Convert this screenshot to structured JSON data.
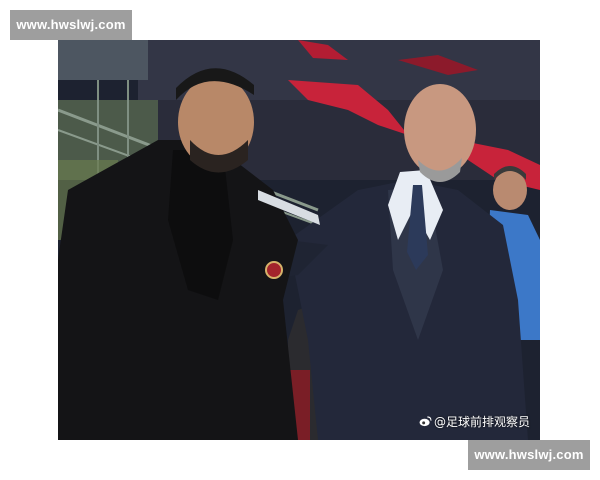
{
  "watermark": {
    "top_text": "www.hwslwj.com",
    "bottom_text": "www.hwslwj.com"
  },
  "photo": {
    "credit": "@足球前排观察员",
    "credit_icon": "weibo-icon"
  },
  "colors": {
    "watermark_bg": "#9e9e9e",
    "banner_red": "#c8233a",
    "stadium_dark": "#1b1e27"
  }
}
